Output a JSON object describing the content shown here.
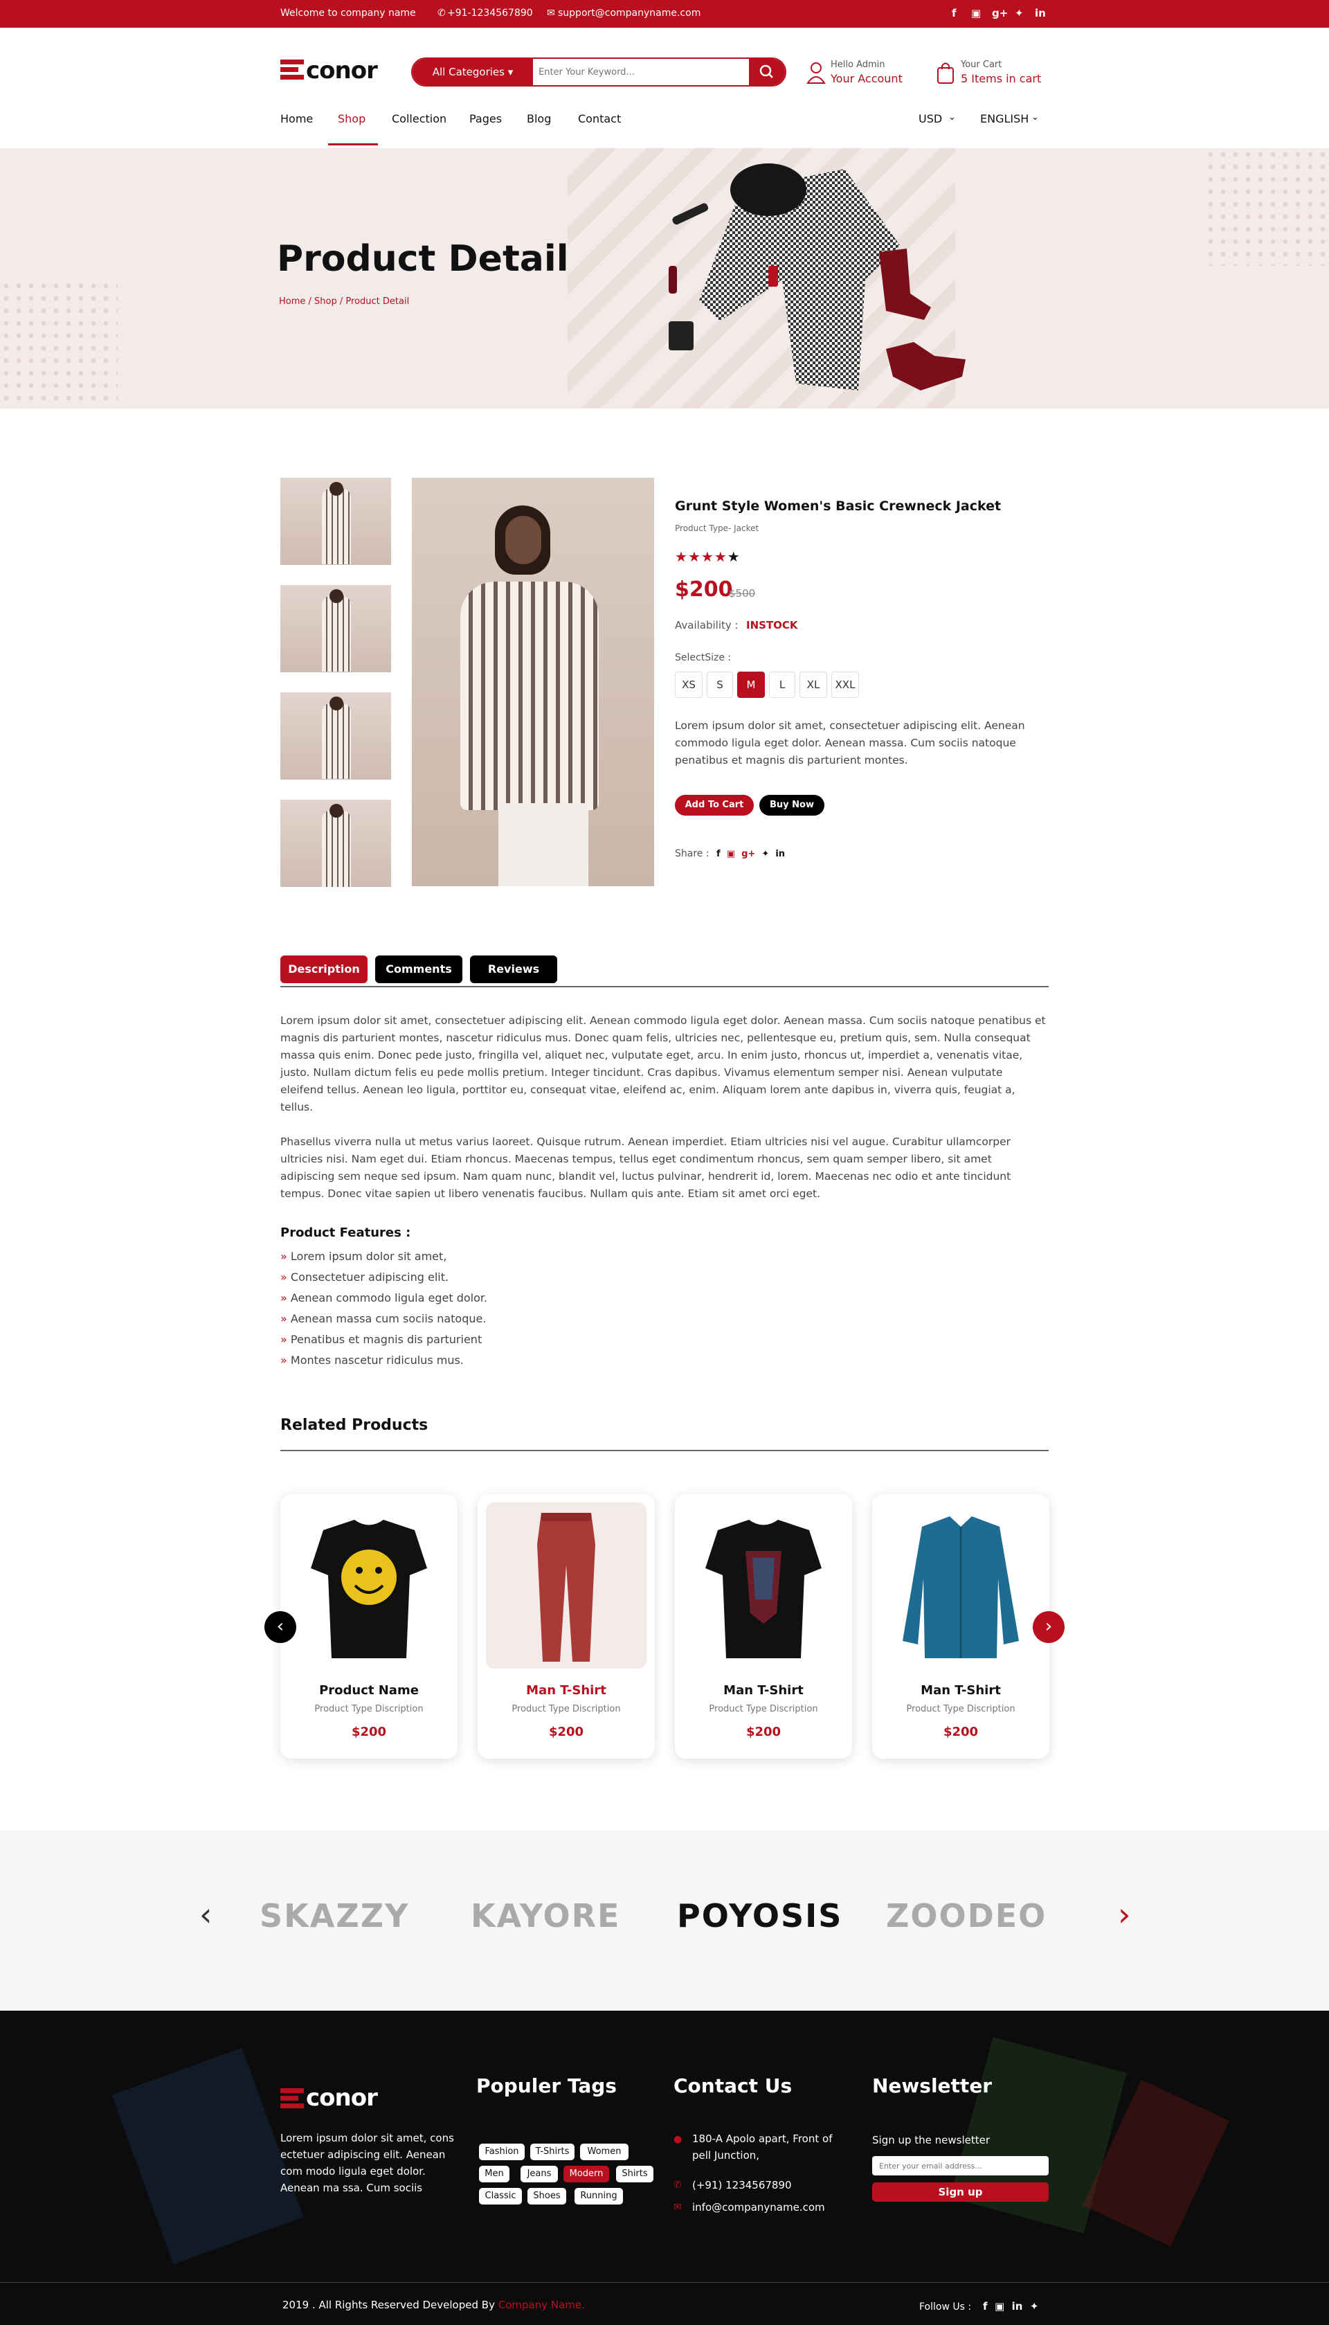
{
  "topbar": {
    "welcome": "Welcome to company name",
    "phone": "+91-1234567890",
    "email": "support@companyname.com",
    "social": [
      "f",
      "▣",
      "g+",
      "✦",
      "in"
    ]
  },
  "header": {
    "logo": "conor",
    "category": "All Categories ▾",
    "search_placeholder": "Enter Your Keyword...",
    "account_small": "Hello Admin",
    "account_big": "Your Account",
    "cart_small": "Your Cart",
    "cart_big": "5 Items in cart"
  },
  "nav": {
    "items": [
      "Home",
      "Shop",
      "Collection",
      "Pages",
      "Blog",
      "Contact"
    ],
    "currency": "USD",
    "language": "ENGLISH"
  },
  "hero": {
    "title": "Product Detail",
    "breadcrumb_home": "Home",
    "breadcrumb_shop": "Shop",
    "breadcrumb_current": "Product Detail"
  },
  "product": {
    "name": "Grunt Style Women's Basic Crewneck Jacket",
    "type": "Product Type- Jacket",
    "rating": 4,
    "rating_max": 5,
    "price": "$200",
    "old_price": "$500",
    "availability_label": "Availability :",
    "availability": "INSTOCK",
    "select_size": "SelectSize :",
    "sizes": [
      "XS",
      "S",
      "M",
      "L",
      "XL",
      "XXL"
    ],
    "selected_size": "M",
    "summary": "Lorem ipsum dolor sit amet, consectetuer adipiscing elit. Aenean commodo ligula eget dolor. Aenean massa. Cum sociis natoque penatibus et magnis dis parturient montes.",
    "add_to_cart": "Add To Cart",
    "buy_now": "Buy Now",
    "share": "Share :"
  },
  "tabs": [
    "Description",
    "Comments",
    "Reviews"
  ],
  "description": {
    "p1": "Lorem ipsum dolor sit amet, consectetuer adipiscing elit. Aenean commodo ligula eget dolor. Aenean massa. Cum sociis natoque penatibus et magnis dis parturient montes, nascetur ridiculus mus. Donec quam felis, ultricies nec, pellentesque eu, pretium quis, sem. Nulla consequat massa quis enim. Donec pede justo, fringilla vel, aliquet nec, vulputate eget, arcu. In enim justo, rhoncus ut, imperdiet a, venenatis vitae, justo. Nullam dictum felis eu pede mollis pretium. Integer tincidunt. Cras dapibus. Vivamus elementum semper nisi. Aenean vulputate eleifend tellus. Aenean leo ligula, porttitor eu, consequat vitae, eleifend ac, enim. Aliquam lorem ante dapibus in, viverra quis, feugiat a, tellus.",
    "p2": "Phasellus viverra nulla ut metus varius laoreet. Quisque rutrum. Aenean imperdiet. Etiam ultricies nisi vel augue. Curabitur ullamcorper ultricies nisi. Nam eget dui. Etiam rhoncus. Maecenas tempus, tellus eget condimentum rhoncus, sem quam semper libero, sit amet adipiscing sem neque sed ipsum. Nam quam nunc, blandit vel, luctus pulvinar, hendrerit id, lorem. Maecenas nec odio et ante tincidunt tempus. Donec vitae sapien ut libero venenatis faucibus. Nullam quis ante. Etiam sit amet orci eget.",
    "features_title": "Product Features :",
    "features": [
      "Lorem ipsum dolor sit amet,",
      "Consectetuer adipiscing elit.",
      "Aenean commodo ligula eget dolor.",
      "Aenean massa cum sociis natoque.",
      "Penatibus et magnis dis parturient",
      "Montes nascetur ridiculus mus."
    ]
  },
  "related": {
    "title": "Related Products",
    "items": [
      {
        "name": "Product Name",
        "desc": "Product Type Discription",
        "price": "$200"
      },
      {
        "name": "Man T-Shirt",
        "desc": "Product Type Discription",
        "price": "$200"
      },
      {
        "name": "Man T-Shirt",
        "desc": "Product Type Discription",
        "price": "$200"
      },
      {
        "name": "Man T-Shirt",
        "desc": "Product Type Discription",
        "price": "$200"
      }
    ]
  },
  "brands": [
    "SKAZZY",
    "KAYORE",
    "POYOSIS",
    "ZOODEO"
  ],
  "footer": {
    "logo": "conor",
    "about": "Lorem ipsum dolor sit amet, cons ectetuer adipiscing elit. Aenean com modo ligula eget dolor. Aenean ma ssa. Cum sociis",
    "tags_title": "Populer Tags",
    "tags": [
      "Fashion",
      "T-Shirts",
      "Women",
      "Men",
      "Jeans",
      "Modern",
      "Shirts",
      "Classic",
      "Shoes",
      "Running"
    ],
    "contact_title": "Contact Us",
    "address": "180-A Apolo apart, Front of pell Junction,",
    "phone": "(+91) 1234567890",
    "email": "info@companyname.com",
    "newsletter_title": "Newsletter",
    "newsletter_text": "Sign up the newsletter",
    "newsletter_placeholder": "Enter your email address...",
    "signup": "Sign up",
    "copyright": "2019 . All Rights Reserved Developed By ",
    "company": "Company Name.",
    "follow": "Follow Us :"
  },
  "colors": {
    "accent": "#b8101f",
    "hero_bg": "#f3ebe9",
    "footer_bg": "#0c0c0c"
  }
}
